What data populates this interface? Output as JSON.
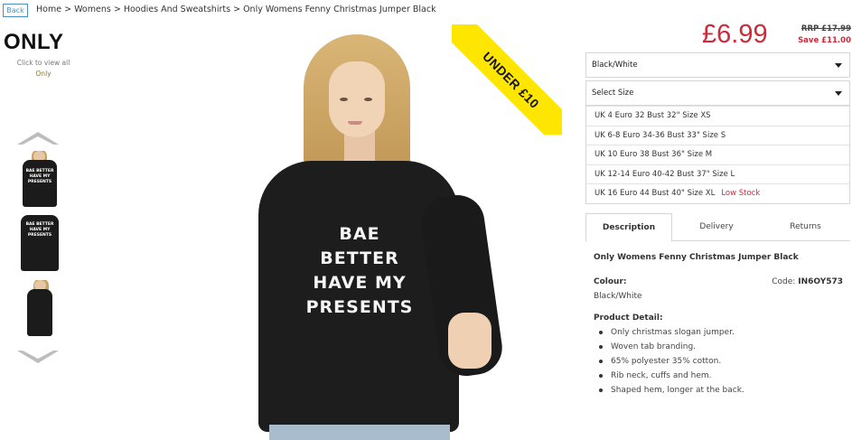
{
  "nav": {
    "back_label": "Back",
    "breadcrumb": [
      "Home",
      "Womens",
      "Hoodies And Sweatshirts",
      "Only Womens Fenny Christmas Jumper Black"
    ],
    "separator": ">"
  },
  "brand": {
    "logo_text": "ONLY",
    "click_text": "Click to view all",
    "link_text": "Only"
  },
  "gallery": {
    "thumb_slogan": "BAE BETTER HAVE MY PRESENTS",
    "image_slogan_lines": [
      "BAE",
      "BETTER",
      "HAVE MY",
      "PRESENTS"
    ],
    "badge": "UNDER £10"
  },
  "product": {
    "price": "£6.99",
    "rrp": "RRP £17.99",
    "save": "Save £11.00",
    "colour_select": "Black/White",
    "size_select": "Select Size",
    "sizes": [
      {
        "label": "UK 4 Euro 32 Bust 32\" Size XS",
        "stock": ""
      },
      {
        "label": "UK 6-8 Euro 34-36 Bust 33\" Size S",
        "stock": ""
      },
      {
        "label": "UK 10 Euro 38 Bust 36\" Size M",
        "stock": ""
      },
      {
        "label": "UK 12-14 Euro 40-42 Bust 37\" Size L",
        "stock": ""
      },
      {
        "label": "UK 16 Euro 44 Bust 40\" Size XL",
        "stock": "Low Stock"
      }
    ]
  },
  "tabs": [
    "Description",
    "Delivery",
    "Returns"
  ],
  "description": {
    "title": "Only Womens Fenny Christmas Jumper Black",
    "colour_label": "Colour:",
    "colour_value": "Black/White",
    "code_label": "Code:",
    "code_value": "IN6OY573",
    "detail_label": "Product Detail:",
    "details": [
      "Only christmas slogan jumper.",
      "Woven tab branding.",
      "65% polyester 35% cotton.",
      "Rib neck, cuffs and hem.",
      "Shaped hem, longer at the back."
    ]
  },
  "colors": {
    "price_red": "#d02a3a",
    "badge_yellow": "#ffe600",
    "link_blue": "#4a90c2"
  }
}
